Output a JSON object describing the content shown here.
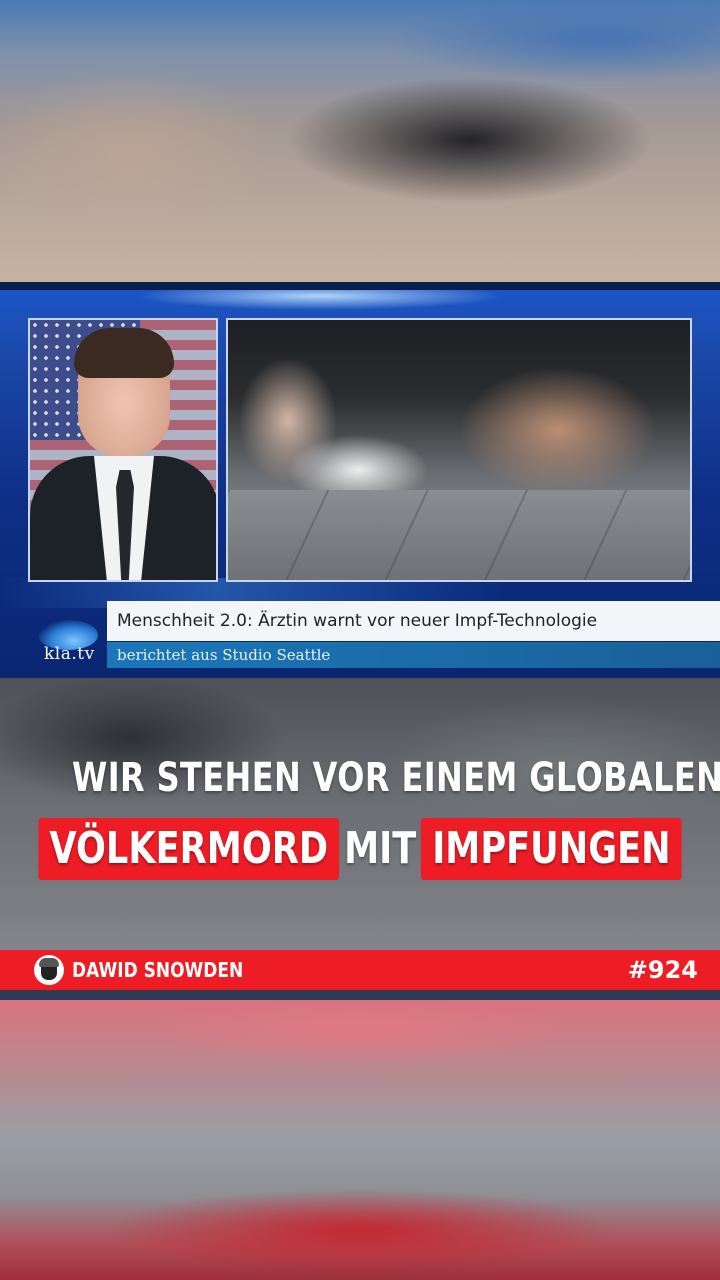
{
  "video": {
    "news_panel": {
      "logo_text": "kla.tv",
      "headline": "Menschheit 2.0: Ärztin warnt vor neuer Impf-Technologie",
      "subline": "berichtet aus Studio Seattle"
    },
    "caption": {
      "line1": "WIR STEHEN VOR EINEM GLOBALEN",
      "line2_highlight1": "VÖLKERMORD",
      "line2_plain": "MIT",
      "line2_highlight2": "IMPFUNGEN"
    },
    "footer_bar": {
      "channel_name": "DAWID SNOWDEN",
      "episode": "#924"
    }
  },
  "colors": {
    "accent_red": "#ee1c25",
    "tv_blue": "#1b47a8",
    "subline_blue": "#1b77b8"
  },
  "icons": {
    "avatar": "channel-avatar-icon",
    "logo": "klatv-logo-icon"
  }
}
